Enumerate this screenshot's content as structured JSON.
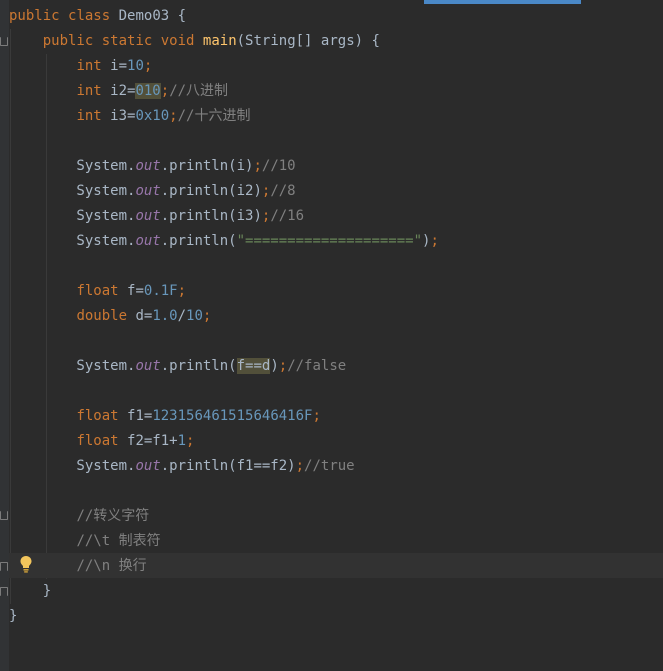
{
  "editor": {
    "lines": [
      [
        {
          "t": "public",
          "c": "kw"
        },
        {
          "t": " "
        },
        {
          "t": "class",
          "c": "kw"
        },
        {
          "t": " Demo03 {"
        }
      ],
      [
        {
          "t": "    "
        },
        {
          "t": "public",
          "c": "kw"
        },
        {
          "t": " "
        },
        {
          "t": "static",
          "c": "kw"
        },
        {
          "t": " "
        },
        {
          "t": "void",
          "c": "kw"
        },
        {
          "t": " "
        },
        {
          "t": "main",
          "c": "fn"
        },
        {
          "t": "(String[] args) {"
        }
      ],
      [
        {
          "t": "        "
        },
        {
          "t": "int",
          "c": "kw"
        },
        {
          "t": " i="
        },
        {
          "t": "10",
          "c": "num"
        },
        {
          "t": ";",
          "c": "kw"
        }
      ],
      [
        {
          "t": "        "
        },
        {
          "t": "int",
          "c": "kw"
        },
        {
          "t": " i2="
        },
        {
          "t": "010",
          "c": "num hl"
        },
        {
          "t": ";",
          "c": "kw"
        },
        {
          "t": "//八进制",
          "c": "cm"
        }
      ],
      [
        {
          "t": "        "
        },
        {
          "t": "int",
          "c": "kw"
        },
        {
          "t": " i3="
        },
        {
          "t": "0x10",
          "c": "num"
        },
        {
          "t": ";",
          "c": "kw"
        },
        {
          "t": "//十六进制",
          "c": "cm"
        }
      ],
      [],
      [
        {
          "t": "        System."
        },
        {
          "t": "out",
          "c": "fld"
        },
        {
          "t": ".println(i)"
        },
        {
          "t": ";",
          "c": "kw"
        },
        {
          "t": "//10",
          "c": "cm"
        }
      ],
      [
        {
          "t": "        System."
        },
        {
          "t": "out",
          "c": "fld"
        },
        {
          "t": ".println(i2)"
        },
        {
          "t": ";",
          "c": "kw"
        },
        {
          "t": "//8",
          "c": "cm"
        }
      ],
      [
        {
          "t": "        System."
        },
        {
          "t": "out",
          "c": "fld"
        },
        {
          "t": ".println(i3)"
        },
        {
          "t": ";",
          "c": "kw"
        },
        {
          "t": "//16",
          "c": "cm"
        }
      ],
      [
        {
          "t": "        System."
        },
        {
          "t": "out",
          "c": "fld"
        },
        {
          "t": ".println("
        },
        {
          "t": "\"====================\"",
          "c": "str"
        },
        {
          "t": ")"
        },
        {
          "t": ";",
          "c": "kw"
        }
      ],
      [],
      [
        {
          "t": "        "
        },
        {
          "t": "float",
          "c": "kw"
        },
        {
          "t": " f="
        },
        {
          "t": "0.1F",
          "c": "num"
        },
        {
          "t": ";",
          "c": "kw"
        }
      ],
      [
        {
          "t": "        "
        },
        {
          "t": "double",
          "c": "kw"
        },
        {
          "t": " d="
        },
        {
          "t": "1.0",
          "c": "num"
        },
        {
          "t": "/"
        },
        {
          "t": "10",
          "c": "num"
        },
        {
          "t": ";",
          "c": "kw"
        }
      ],
      [],
      [
        {
          "t": "        System."
        },
        {
          "t": "out",
          "c": "fld"
        },
        {
          "t": ".println("
        },
        {
          "t": "f==d",
          "c": "hl"
        },
        {
          "t": ")"
        },
        {
          "t": ";",
          "c": "kw"
        },
        {
          "t": "//false",
          "c": "cm"
        }
      ],
      [],
      [
        {
          "t": "        "
        },
        {
          "t": "float",
          "c": "kw"
        },
        {
          "t": " f1="
        },
        {
          "t": "123156461515646416F",
          "c": "num"
        },
        {
          "t": ";",
          "c": "kw"
        }
      ],
      [
        {
          "t": "        "
        },
        {
          "t": "float",
          "c": "kw"
        },
        {
          "t": " f2=f1+"
        },
        {
          "t": "1",
          "c": "num"
        },
        {
          "t": ";",
          "c": "kw"
        }
      ],
      [
        {
          "t": "        System."
        },
        {
          "t": "out",
          "c": "fld"
        },
        {
          "t": ".println(f1==f2)"
        },
        {
          "t": ";",
          "c": "kw"
        },
        {
          "t": "//true",
          "c": "cm"
        }
      ],
      [],
      [
        {
          "t": "        "
        },
        {
          "t": "//转义字符",
          "c": "cm"
        }
      ],
      [
        {
          "t": "        "
        },
        {
          "t": "//\\t 制表符",
          "c": "cm"
        }
      ],
      [
        {
          "t": "        "
        },
        {
          "t": "//\\n 换行",
          "c": "cm"
        }
      ],
      [
        {
          "t": "    }"
        }
      ],
      [
        {
          "t": "}"
        }
      ]
    ]
  },
  "icons": {
    "intention": "lightbulb-icon",
    "fold": "fold-marker-icon"
  },
  "colors": {
    "background": "#2b2b2b",
    "keyword": "#cc7832",
    "number": "#6897bb",
    "comment": "#808080",
    "method": "#ffc66d",
    "field": "#9876aa",
    "string": "#6a8759",
    "highlight": "#52503a"
  }
}
